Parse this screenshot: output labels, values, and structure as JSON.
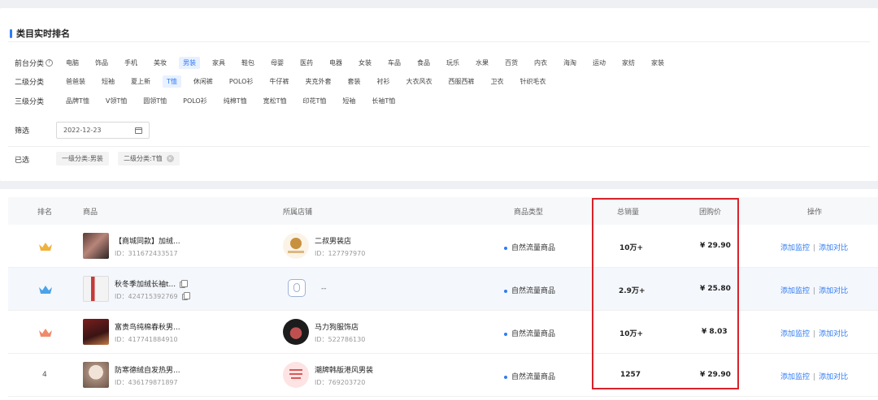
{
  "panel": {
    "title": "类目实时排名",
    "row1_label": "前台分类",
    "row1_items": [
      "电脑",
      "饰品",
      "手机",
      "美妆",
      "男装",
      "家具",
      "鞋包",
      "母婴",
      "医药",
      "电器",
      "女装",
      "车品",
      "食品",
      "玩乐",
      "水果",
      "百货",
      "内衣",
      "海淘",
      "运动",
      "家纺",
      "家装"
    ],
    "row1_active": "男装",
    "row2_label": "二级分类",
    "row2_items": [
      "爸爸装",
      "短袖",
      "夏上新",
      "T恤",
      "休闲裤",
      "POLO衫",
      "牛仔裤",
      "夹克外套",
      "套装",
      "衬衫",
      "大衣风衣",
      "西服西裤",
      "卫衣",
      "针织毛衣"
    ],
    "row2_active": "T恤",
    "row3_label": "三级分类",
    "row3_items": [
      "品牌T恤",
      "V领T恤",
      "圆领T恤",
      "POLO衫",
      "纯棉T恤",
      "宽松T恤",
      "印花T恤",
      "短袖",
      "长袖T恤"
    ],
    "filter_label": "筛选",
    "date_value": "2022-12-23",
    "selected_label": "已选",
    "selected_tags": [
      "一级分类:男装",
      "二级分类:T恤"
    ]
  },
  "table": {
    "headers": {
      "rank": "排名",
      "product": "商品",
      "shop": "所属店铺",
      "type": "商品类型",
      "sales": "总销量",
      "price": "团购价",
      "ops": "操作"
    },
    "rows": [
      {
        "rank": "",
        "product_name": "【商城同款】加绒...",
        "product_id": "ID：311672433517",
        "shop_name": "二叔男装店",
        "shop_id": "ID：127797970",
        "type": "自然流量商品",
        "sales": "10万+",
        "price": "¥ 29.90",
        "op_monitor": "添加监控",
        "op_compare": "添加对比"
      },
      {
        "rank": "",
        "product_name": "秋冬季加绒长袖t...",
        "product_id": "ID：424715392769",
        "shop_name": "--",
        "shop_id": "",
        "type": "自然流量商品",
        "sales": "2.9万+",
        "price": "¥ 25.80",
        "op_monitor": "添加监控",
        "op_compare": "添加对比"
      },
      {
        "rank": "",
        "product_name": "富贵鸟纯棉春秋男...",
        "product_id": "ID：417741884910",
        "shop_name": "马力狗服饰店",
        "shop_id": "ID：522786130",
        "type": "自然流量商品",
        "sales": "10万+",
        "price": "¥ 8.03",
        "op_monitor": "添加监控",
        "op_compare": "添加对比"
      },
      {
        "rank": "4",
        "product_name": "防寒德绒自发热男...",
        "product_id": "ID：436179871897",
        "shop_name": "潮牌韩版港风男装",
        "shop_id": "ID：769203720",
        "type": "自然流量商品",
        "sales": "1257",
        "price": "¥ 29.90",
        "op_monitor": "添加监控",
        "op_compare": "添加对比"
      }
    ],
    "op_separator": "|"
  },
  "colors": {
    "accent": "#2f7bf5",
    "highlight_box": "#d8222a",
    "crown_gold": "#f0b23c",
    "crown_silver": "#4aa3e8",
    "crown_bronze": "#f08a6a"
  }
}
